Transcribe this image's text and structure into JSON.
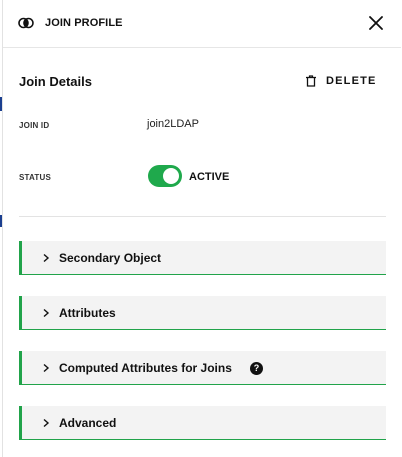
{
  "header": {
    "title": "JOIN PROFILE",
    "icon": "join-circles-icon",
    "close_icon": "close-icon"
  },
  "details": {
    "title": "Join Details",
    "delete_label": "DELETE",
    "delete_icon": "trash-icon"
  },
  "fields": {
    "join_id_label": "JOIN ID",
    "join_id_value": "join2LDAP",
    "status_label": "STATUS",
    "status_value": "ACTIVE",
    "status_on": true
  },
  "sections": [
    {
      "label": "Secondary Object"
    },
    {
      "label": "Attributes"
    },
    {
      "label": "Computed Attributes for Joins",
      "help_icon": "?"
    },
    {
      "label": "Advanced"
    }
  ],
  "colors": {
    "accent_green": "#21a34a",
    "toggle_green": "#1fa94c",
    "left_strip": "#1b3f8f"
  }
}
